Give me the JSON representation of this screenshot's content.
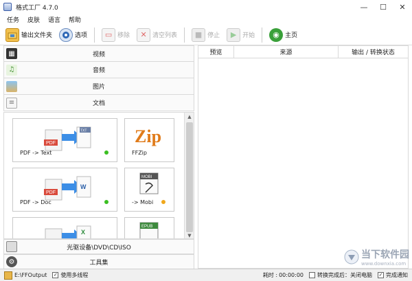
{
  "window": {
    "title": "格式工厂 4.7.0",
    "min": "—",
    "max": "☐",
    "close": "✕"
  },
  "menu": [
    "任务",
    "皮肤",
    "语言",
    "帮助"
  ],
  "toolbar": {
    "output_folder": "输出文件夹",
    "options": "选项",
    "remove": "移除",
    "clear_list": "清空列表",
    "stop": "停止",
    "start": "开始",
    "home": "主页"
  },
  "categories": {
    "video": "视频",
    "audio": "音频",
    "image": "图片",
    "document": "文档",
    "optical": "光驱设备\\DVD\\CD\\ISO",
    "tools": "工具集"
  },
  "tiles": {
    "pdf_text": {
      "label": "PDF -> Text",
      "badge": "TXT",
      "pdf": "PDF",
      "status_color": "#3bbf22"
    },
    "ffzip": {
      "label": "FFZip",
      "logo": "Zip"
    },
    "pdf_doc": {
      "label": "PDF -> Doc",
      "badge": "W",
      "pdf": "PDF",
      "status_color": "#3bbf22"
    },
    "mobi": {
      "label": "-> Mobi",
      "badge": "MOBI",
      "status_color": "#f0a81c"
    },
    "pdf_xls": {
      "badge": "X"
    },
    "epub": {
      "badge": "EPUB"
    }
  },
  "columns": {
    "preview": "预览",
    "source": "来源",
    "status": "输出 / 转换状态"
  },
  "status": {
    "output_path": "E:\\FFOutput",
    "multithread_label": "使用多线程",
    "multithread_checked": true,
    "elapsed_label": "耗时 :",
    "elapsed_value": "00:00:00",
    "after_convert": "转换完成后：关闭电脑",
    "after_checked": false,
    "notify_label": "完成通知",
    "notify_checked": true
  },
  "watermark": {
    "cn": "当下软件园",
    "url": "www.downxia.com"
  }
}
